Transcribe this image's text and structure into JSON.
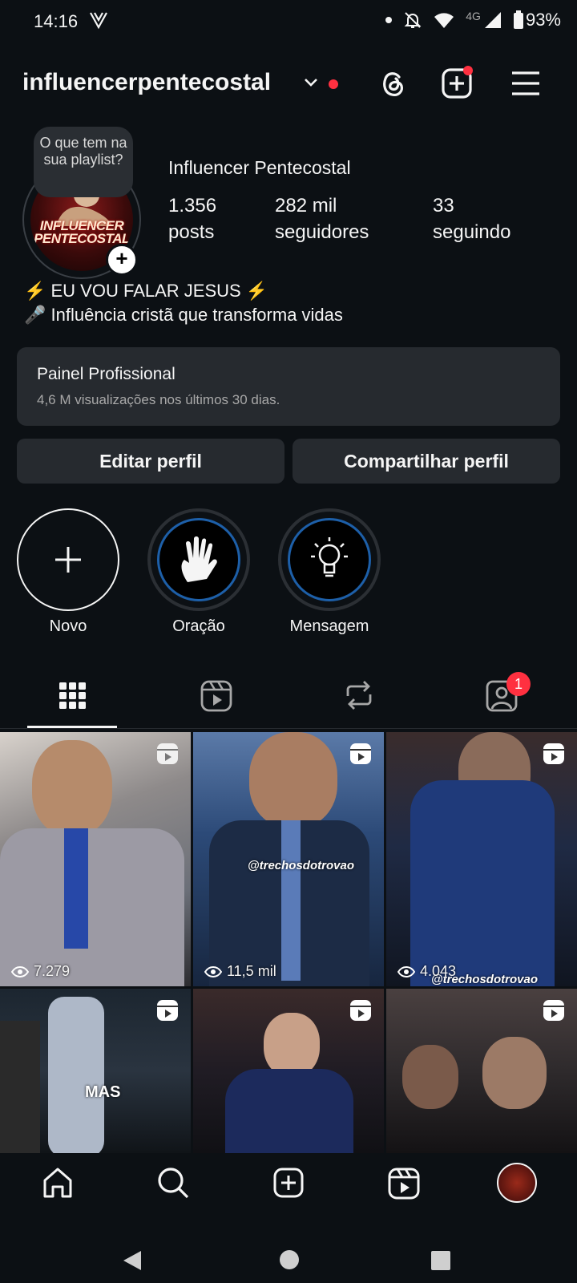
{
  "status_bar": {
    "time": "14:16",
    "network": "4G",
    "battery": "93%"
  },
  "header": {
    "username": "influencerpentecostal",
    "icons": [
      "threads-icon",
      "create-icon",
      "menu-icon"
    ]
  },
  "profile": {
    "note_bubble": "O que tem na sua playlist?",
    "avatar_text": "INFLUENCER PENTECOSTAL",
    "display_name": "Influencer Pentecostal",
    "stats": [
      {
        "value": "1.356",
        "label": "posts"
      },
      {
        "value": "282 mil",
        "label": "seguidores"
      },
      {
        "value": "33",
        "label": "seguindo"
      }
    ],
    "bio_line1": "⚡ EU VOU FALAR JESUS ⚡",
    "bio_line2": "🎤 Influência cristã que transforma vidas"
  },
  "professional_panel": {
    "title": "Painel Profissional",
    "subtitle": "4,6 M visualizações nos últimos 30 dias."
  },
  "buttons": {
    "edit": "Editar perfil",
    "share": "Compartilhar perfil"
  },
  "highlights": [
    {
      "label": "Novo",
      "icon": "plus-icon"
    },
    {
      "label": "Oração",
      "icon": "hand-icon"
    },
    {
      "label": "Mensagem",
      "icon": "lightbulb-icon"
    }
  ],
  "tabs": [
    {
      "name": "grid",
      "icon": "grid-icon",
      "active": true
    },
    {
      "name": "reels",
      "icon": "reels-icon"
    },
    {
      "name": "reposts",
      "icon": "repost-icon"
    },
    {
      "name": "tagged",
      "icon": "tagged-icon",
      "badge": "1"
    }
  ],
  "grid_items": [
    {
      "views": "7.279",
      "watermark": ""
    },
    {
      "views": "11,5 mil",
      "watermark": "@trechosdotrovao"
    },
    {
      "views": "4.043",
      "watermark": "@trechosdotrovao"
    },
    {
      "views": "",
      "watermark": "MAS"
    },
    {
      "views": "",
      "watermark": ""
    },
    {
      "views": "",
      "watermark": ""
    }
  ],
  "bottom_nav": [
    "home-icon",
    "search-icon",
    "create-icon",
    "reels-icon",
    "profile-avatar"
  ]
}
